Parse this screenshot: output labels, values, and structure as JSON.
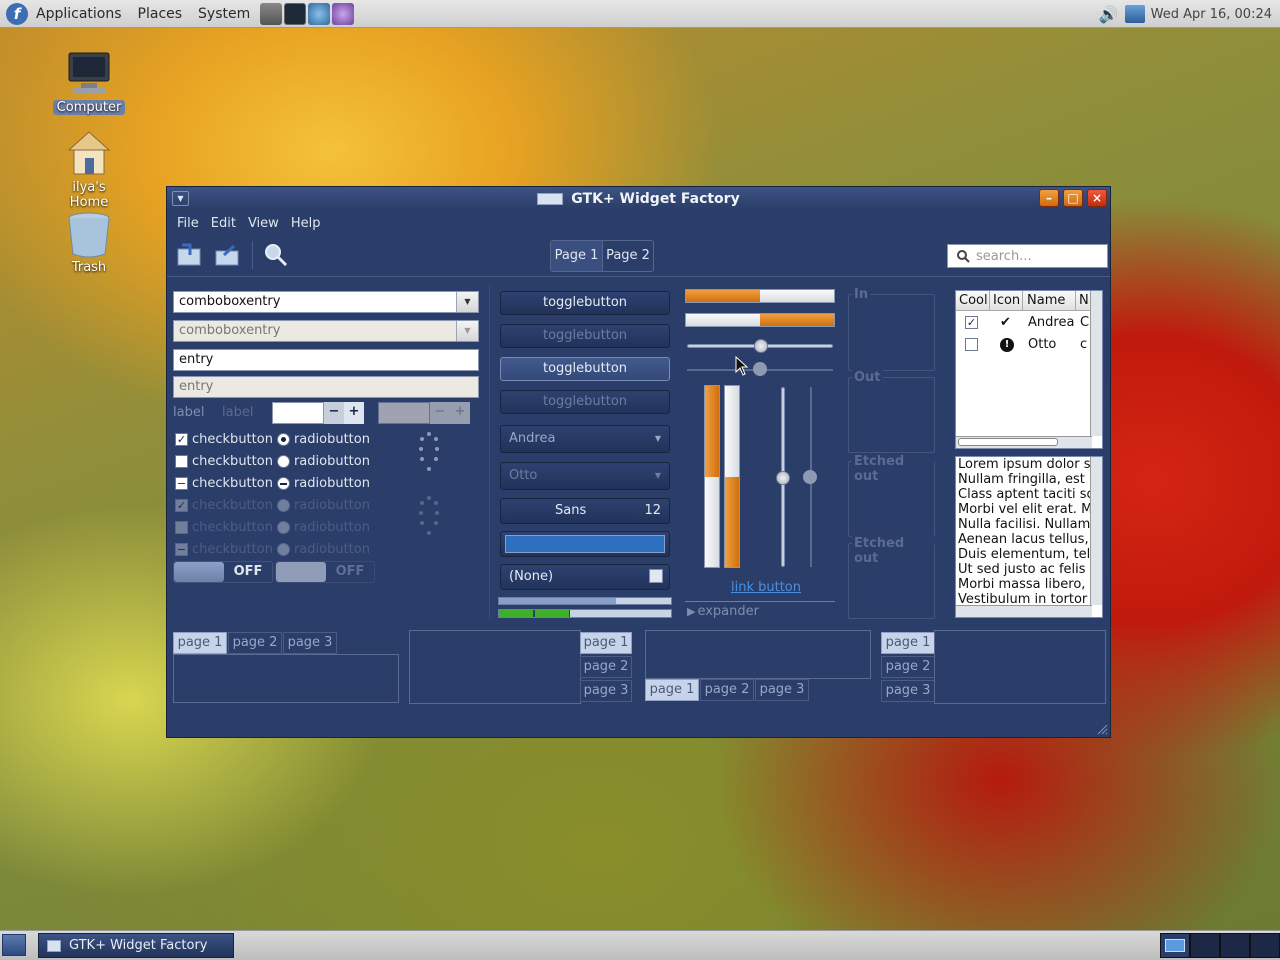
{
  "topbar": {
    "menus": [
      "Applications",
      "Places",
      "System"
    ],
    "clock": "Wed Apr 16, 00:24"
  },
  "desktop": {
    "icons": [
      "Computer",
      "ilya's Home",
      "Trash"
    ]
  },
  "window": {
    "title": "GTK+ Widget Factory",
    "menu": [
      "File",
      "Edit",
      "View",
      "Help"
    ],
    "toolbar": {
      "page_tabs": [
        "Page 1",
        "Page 2"
      ],
      "search_placeholder": "search..."
    },
    "col1": {
      "combo1": "comboboxentry",
      "combo2": "comboboxentry",
      "entry1": "entry",
      "entry2": "entry",
      "label1": "label",
      "label2": "label",
      "check": "checkbutton",
      "radio": "radiobutton",
      "switch_off": "OFF"
    },
    "col2": {
      "toggle": "togglebutton",
      "combo1": "Andrea",
      "combo2": "Otto",
      "font_name": "Sans",
      "font_size": "12",
      "file_none": "(None)",
      "progress": [
        0.68,
        0.41
      ]
    },
    "col3": {
      "link": "link button",
      "expander": "expander",
      "hprogress": [
        0.5,
        0.5
      ],
      "scale_values": [
        0.5,
        0.5
      ]
    },
    "frames": [
      "In",
      "Out",
      "Etched out",
      "Etched out"
    ],
    "tree": {
      "columns": [
        "Cool",
        "Icon",
        "Name",
        "N"
      ],
      "rows": [
        {
          "cool": true,
          "name": "Andrea",
          "n": "C"
        },
        {
          "cool": false,
          "name": "Otto",
          "n": "c"
        }
      ]
    },
    "text_lines": [
      "Lorem ipsum dolor si",
      "Nullam fringilla, est u",
      "Class aptent taciti so",
      "Morbi vel elit erat. Ma",
      "Nulla facilisi. Nullam e",
      "Aenean lacus tellus, p",
      "Duis elementum, tell",
      "Ut sed justo ac felis p",
      "Morbi massa libero, c",
      "Vestibulum in tortor c"
    ],
    "notebook_tabs": [
      "page 1",
      "page 2",
      "page 3"
    ]
  },
  "taskbar": {
    "task": "GTK+ Widget Factory"
  },
  "colors": {
    "window_bg": "#2b3d69",
    "accent_orange": "#e08a1e",
    "progress_green": "#3fae2a"
  }
}
